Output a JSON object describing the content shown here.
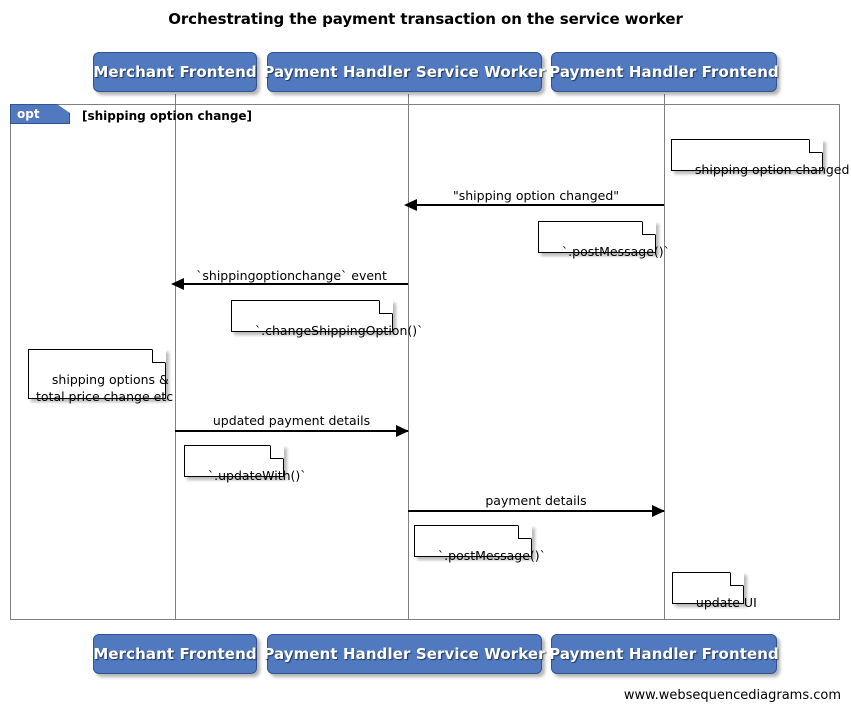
{
  "title": "Orchestrating the payment transaction on the service worker",
  "colors": {
    "actor_fill": "#5079bf",
    "actor_border": "#33538f",
    "actor_text": "#ffffff",
    "frame_border": "#808080",
    "lifeline": "#808080",
    "note_fill": "#ffffff",
    "note_border": "#000000",
    "message": "#000000"
  },
  "actors": [
    {
      "id": "merchant-frontend",
      "label": "Merchant Frontend"
    },
    {
      "id": "payment-handler-service-worker",
      "label": "Payment Handler Service Worker"
    },
    {
      "id": "payment-handler-frontend",
      "label": "Payment Handler Frontend"
    }
  ],
  "fragment": {
    "tag": "opt",
    "condition": "[shipping option change]"
  },
  "messages": [
    {
      "id": "shipping-option-changed",
      "label": "\"shipping option changed\"",
      "from": "payment-handler-frontend",
      "to": "payment-handler-service-worker",
      "direction": "left"
    },
    {
      "id": "shippingoptionchange-event",
      "label": "`shippingoptionchange` event",
      "from": "payment-handler-service-worker",
      "to": "merchant-frontend",
      "direction": "left"
    },
    {
      "id": "updated-payment-details",
      "label": "updated payment details",
      "from": "merchant-frontend",
      "to": "payment-handler-service-worker",
      "direction": "right"
    },
    {
      "id": "payment-details",
      "label": "payment details",
      "from": "payment-handler-service-worker",
      "to": "payment-handler-frontend",
      "direction": "right"
    }
  ],
  "notes": [
    {
      "id": "note-shipping-option-changed",
      "text": "shipping option changed"
    },
    {
      "id": "note-post-message-1",
      "text": "`.postMessage()`"
    },
    {
      "id": "note-change-shipping-option",
      "text": "`.changeShippingOption()`"
    },
    {
      "id": "note-shipping-options-total-price",
      "text": "shipping options &\ntotal price change etc"
    },
    {
      "id": "note-update-with",
      "text": "`.updateWith()`"
    },
    {
      "id": "note-post-message-2",
      "text": "`.postMessage()`"
    },
    {
      "id": "note-update-ui",
      "text": "update UI"
    }
  ],
  "footer": {
    "watermark": "www.websequencediagrams.com"
  }
}
